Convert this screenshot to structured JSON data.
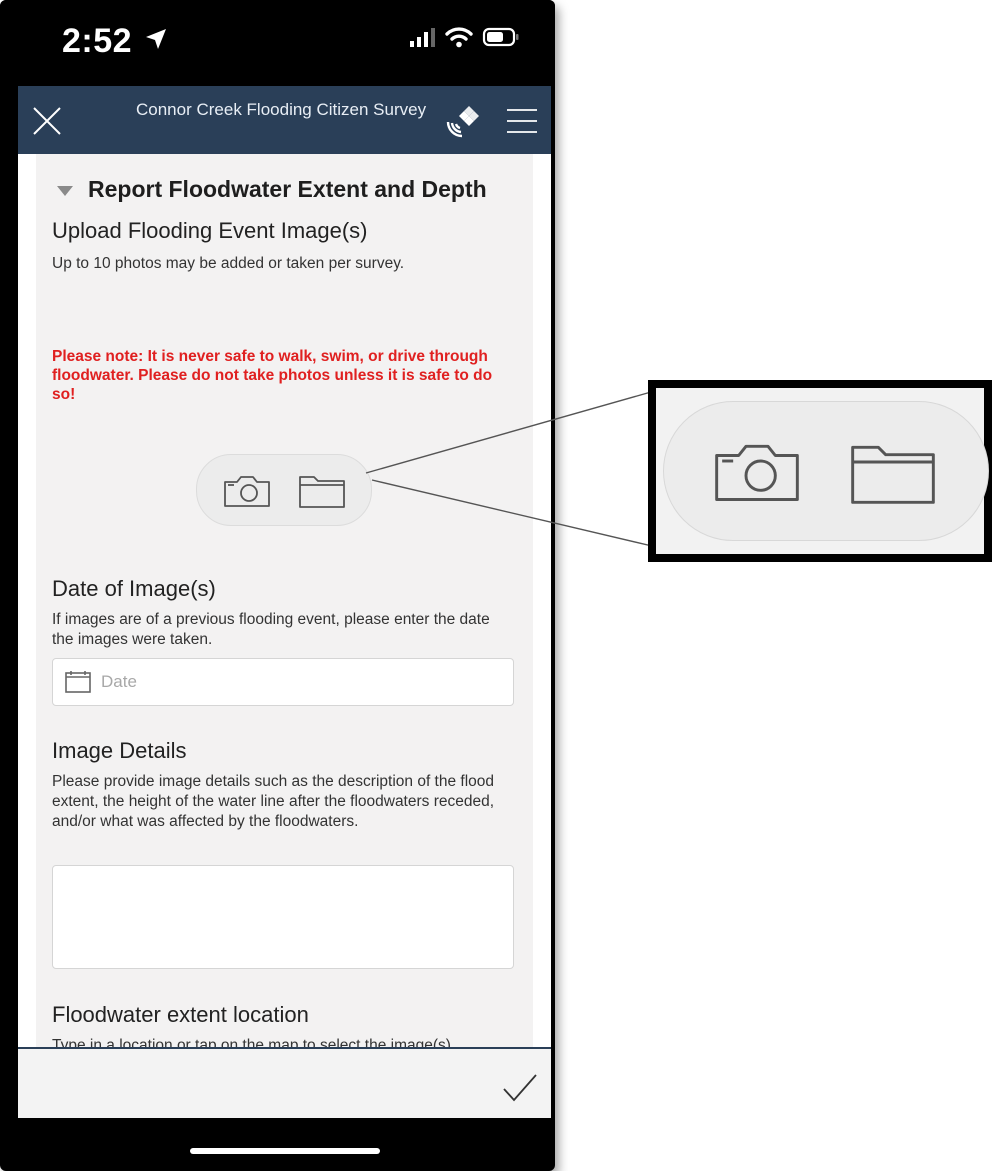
{
  "status_bar": {
    "time": "2:52"
  },
  "header": {
    "title": "Connor Creek Flooding Citizen Survey"
  },
  "section": {
    "title": "Report Floodwater Extent and Depth"
  },
  "upload": {
    "title": "Upload Flooding Event Image(s)",
    "description": "Up to 10 photos may be added or taken per survey.",
    "warning": "Please note: It is never safe to walk, swim, or drive through floodwater. Please do not take photos unless it is safe to do so!"
  },
  "date_question": {
    "title": "Date of Image(s)",
    "description": "If images are of a previous flooding event, please enter the date the images were taken.",
    "placeholder": "Date"
  },
  "details_question": {
    "title": "Image Details",
    "description": "Please provide image details such as the description of the flood extent, the height of the water line after the floodwaters receded, and/or what was affected by the floodwaters."
  },
  "location_question": {
    "title": "Floodwater extent location",
    "description": "Type in a location or tap on the map to select the image(s)"
  },
  "icons": {
    "close": "close-icon",
    "satellite": "satellite-icon",
    "menu": "hamburger-menu-icon",
    "camera": "camera-icon",
    "folder": "folder-icon",
    "calendar": "calendar-icon",
    "submit": "checkmark-icon"
  },
  "colors": {
    "header_bg": "#2a3f58",
    "warning_text": "#e02020",
    "panel_bg": "#f3f2f2"
  }
}
